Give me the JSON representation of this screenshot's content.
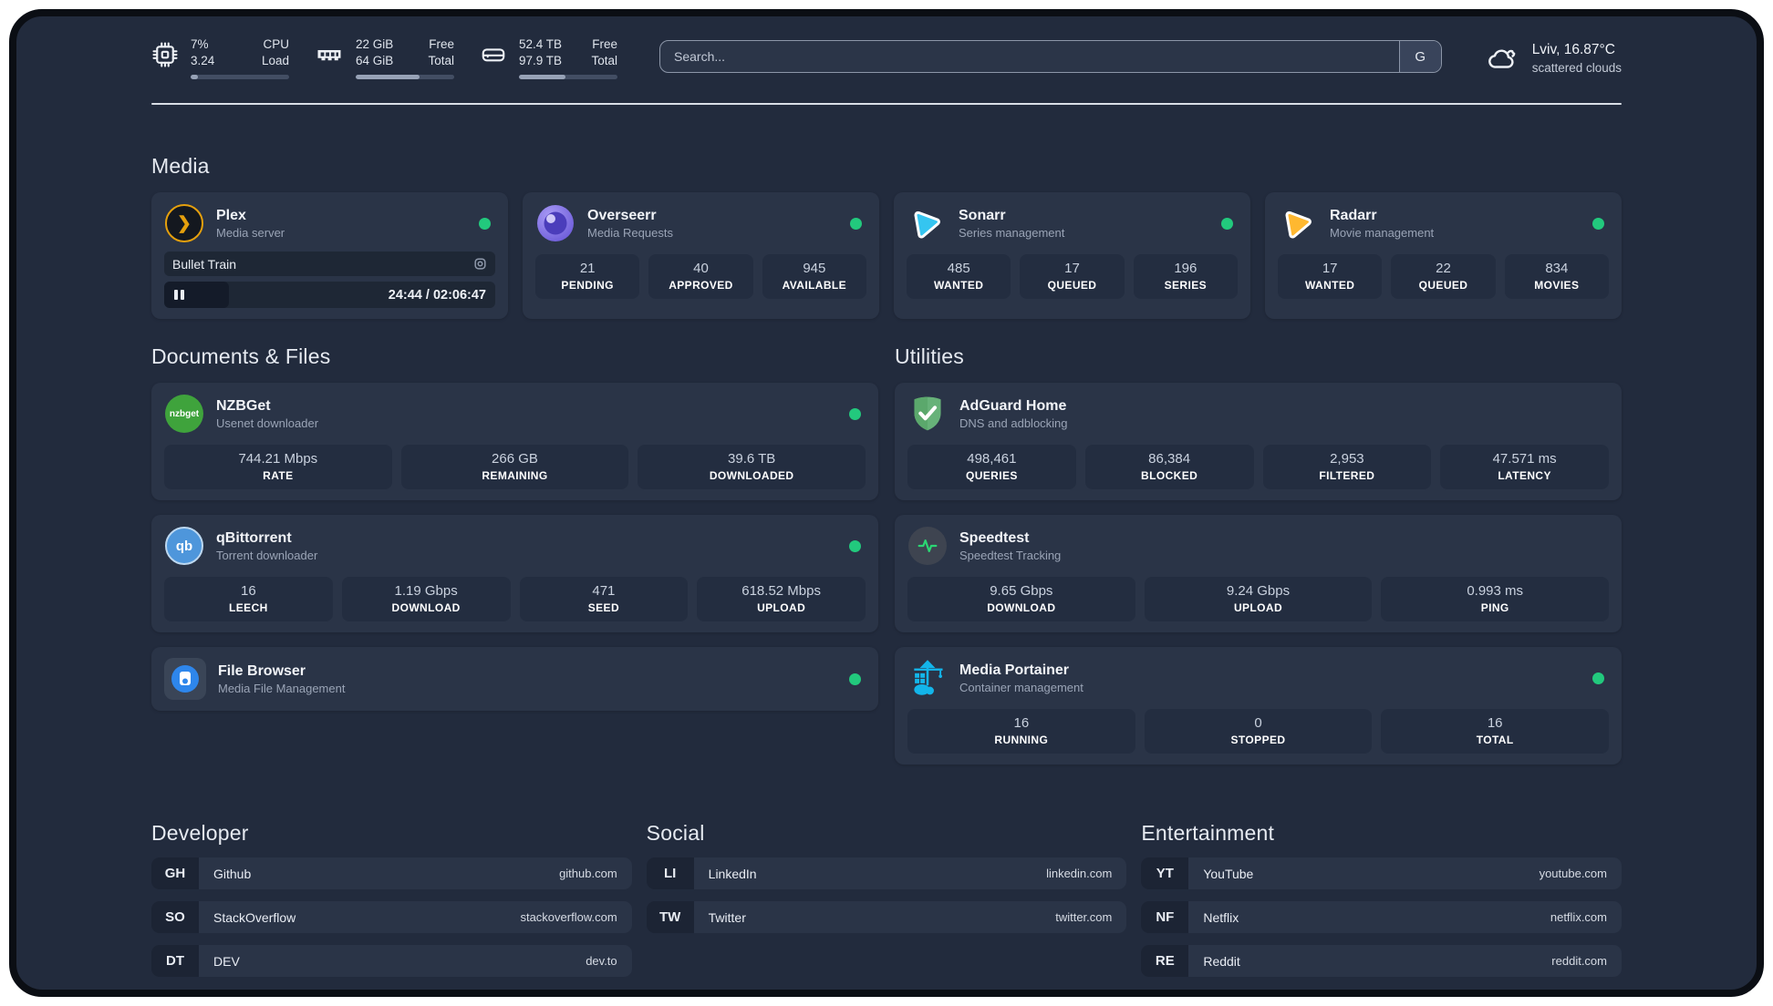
{
  "header": {
    "resources": [
      {
        "icon": "cpu-chip-icon",
        "values": [
          "7%",
          "3.24"
        ],
        "labels": [
          "CPU",
          "Load"
        ],
        "progress_pct": 7
      },
      {
        "icon": "memory-icon",
        "values": [
          "22 GiB",
          "64 GiB"
        ],
        "labels": [
          "Free",
          "Total"
        ],
        "progress_pct": 65
      },
      {
        "icon": "hard-drive-icon",
        "values": [
          "52.4 TB",
          "97.9 TB"
        ],
        "labels": [
          "Free",
          "Total"
        ],
        "progress_pct": 47
      }
    ],
    "search": {
      "placeholder": "Search...",
      "provider_button": "G"
    },
    "weather": {
      "icon": "scattered-clouds-icon",
      "location_temp": "Lviv, 16.87°C",
      "condition": "scattered clouds"
    }
  },
  "sections": {
    "media": {
      "title": "Media",
      "cards": [
        {
          "title": "Plex",
          "subtitle": "Media server",
          "icon": "plex-icon",
          "icon_glyph": "❯",
          "status_dot": true,
          "now_playing": {
            "title": "Bullet Train",
            "time_display": "24:44 / 02:06:47",
            "progress_pct": 19.5
          }
        },
        {
          "title": "Overseerr",
          "subtitle": "Media Requests",
          "icon": "overseerr-icon",
          "status_dot": true,
          "stats": [
            {
              "value": "21",
              "label": "PENDING"
            },
            {
              "value": "40",
              "label": "APPROVED"
            },
            {
              "value": "945",
              "label": "AVAILABLE"
            }
          ]
        },
        {
          "title": "Sonarr",
          "subtitle": "Series management",
          "icon": "sonarr-icon",
          "status_dot": true,
          "stats": [
            {
              "value": "485",
              "label": "WANTED"
            },
            {
              "value": "17",
              "label": "QUEUED"
            },
            {
              "value": "196",
              "label": "SERIES"
            }
          ]
        },
        {
          "title": "Radarr",
          "subtitle": "Movie management",
          "icon": "radarr-icon",
          "status_dot": true,
          "stats": [
            {
              "value": "17",
              "label": "WANTED"
            },
            {
              "value": "22",
              "label": "QUEUED"
            },
            {
              "value": "834",
              "label": "MOVIES"
            }
          ]
        }
      ]
    },
    "documents": {
      "title": "Documents & Files",
      "cards": [
        {
          "title": "NZBGet",
          "subtitle": "Usenet downloader",
          "icon": "nzbget-icon",
          "icon_text": "nzbget",
          "status_dot": true,
          "stats": [
            {
              "value": "744.21 Mbps",
              "label": "RATE"
            },
            {
              "value": "266 GB",
              "label": "REMAINING"
            },
            {
              "value": "39.6 TB",
              "label": "DOWNLOADED"
            }
          ]
        },
        {
          "title": "qBittorrent",
          "subtitle": "Torrent downloader",
          "icon": "qbittorrent-icon",
          "icon_text": "qb",
          "status_dot": true,
          "stats": [
            {
              "value": "16",
              "label": "LEECH"
            },
            {
              "value": "1.19 Gbps",
              "label": "DOWNLOAD"
            },
            {
              "value": "471",
              "label": "SEED"
            },
            {
              "value": "618.52 Mbps",
              "label": "UPLOAD"
            }
          ]
        },
        {
          "title": "File Browser",
          "subtitle": "Media File Management",
          "icon": "filebrowser-icon",
          "status_dot": true
        }
      ]
    },
    "utilities": {
      "title": "Utilities",
      "cards": [
        {
          "title": "AdGuard Home",
          "subtitle": "DNS and adblocking",
          "icon": "adguard-icon",
          "status_dot": false,
          "stats": [
            {
              "value": "498,461",
              "label": "QUERIES"
            },
            {
              "value": "86,384",
              "label": "BLOCKED"
            },
            {
              "value": "2,953",
              "label": "FILTERED"
            },
            {
              "value": "47.571 ms",
              "label": "LATENCY"
            }
          ]
        },
        {
          "title": "Speedtest",
          "subtitle": "Speedtest Tracking",
          "icon": "speedtest-icon",
          "status_dot": false,
          "stats": [
            {
              "value": "9.65 Gbps",
              "label": "DOWNLOAD"
            },
            {
              "value": "9.24 Gbps",
              "label": "UPLOAD"
            },
            {
              "value": "0.993 ms",
              "label": "PING"
            }
          ]
        },
        {
          "title": "Media Portainer",
          "subtitle": "Container management",
          "icon": "portainer-icon",
          "status_dot": true,
          "stats": [
            {
              "value": "16",
              "label": "RUNNING"
            },
            {
              "value": "0",
              "label": "STOPPED"
            },
            {
              "value": "16",
              "label": "TOTAL"
            }
          ]
        }
      ]
    },
    "bookmarks": [
      {
        "title": "Developer",
        "links": [
          {
            "abbr": "GH",
            "name": "Github",
            "url": "github.com"
          },
          {
            "abbr": "SO",
            "name": "StackOverflow",
            "url": "stackoverflow.com"
          },
          {
            "abbr": "DT",
            "name": "DEV",
            "url": "dev.to"
          }
        ]
      },
      {
        "title": "Social",
        "links": [
          {
            "abbr": "LI",
            "name": "LinkedIn",
            "url": "linkedin.com"
          },
          {
            "abbr": "TW",
            "name": "Twitter",
            "url": "twitter.com"
          }
        ]
      },
      {
        "title": "Entertainment",
        "links": [
          {
            "abbr": "YT",
            "name": "YouTube",
            "url": "youtube.com"
          },
          {
            "abbr": "NF",
            "name": "Netflix",
            "url": "netflix.com"
          },
          {
            "abbr": "RE",
            "name": "Reddit",
            "url": "reddit.com"
          }
        ]
      }
    ]
  },
  "colors": {
    "page_bg": "#222B3D",
    "card_bg": "#2A3447",
    "stat_bg": "#232D40",
    "status_online": "#22C97D",
    "plex_amber": "#E5A00D",
    "sonarr_blue": "#35C5F0",
    "radarr_yellow": "#FFB830",
    "nzbget_green": "#3FA33C",
    "qbittorrent_blue": "#4E96DB",
    "adguard_green": "#67B279",
    "speedtest_green": "#2BD673",
    "portainer_blue": "#13B5EA",
    "filebrowser_blue": "#2E86EB"
  }
}
